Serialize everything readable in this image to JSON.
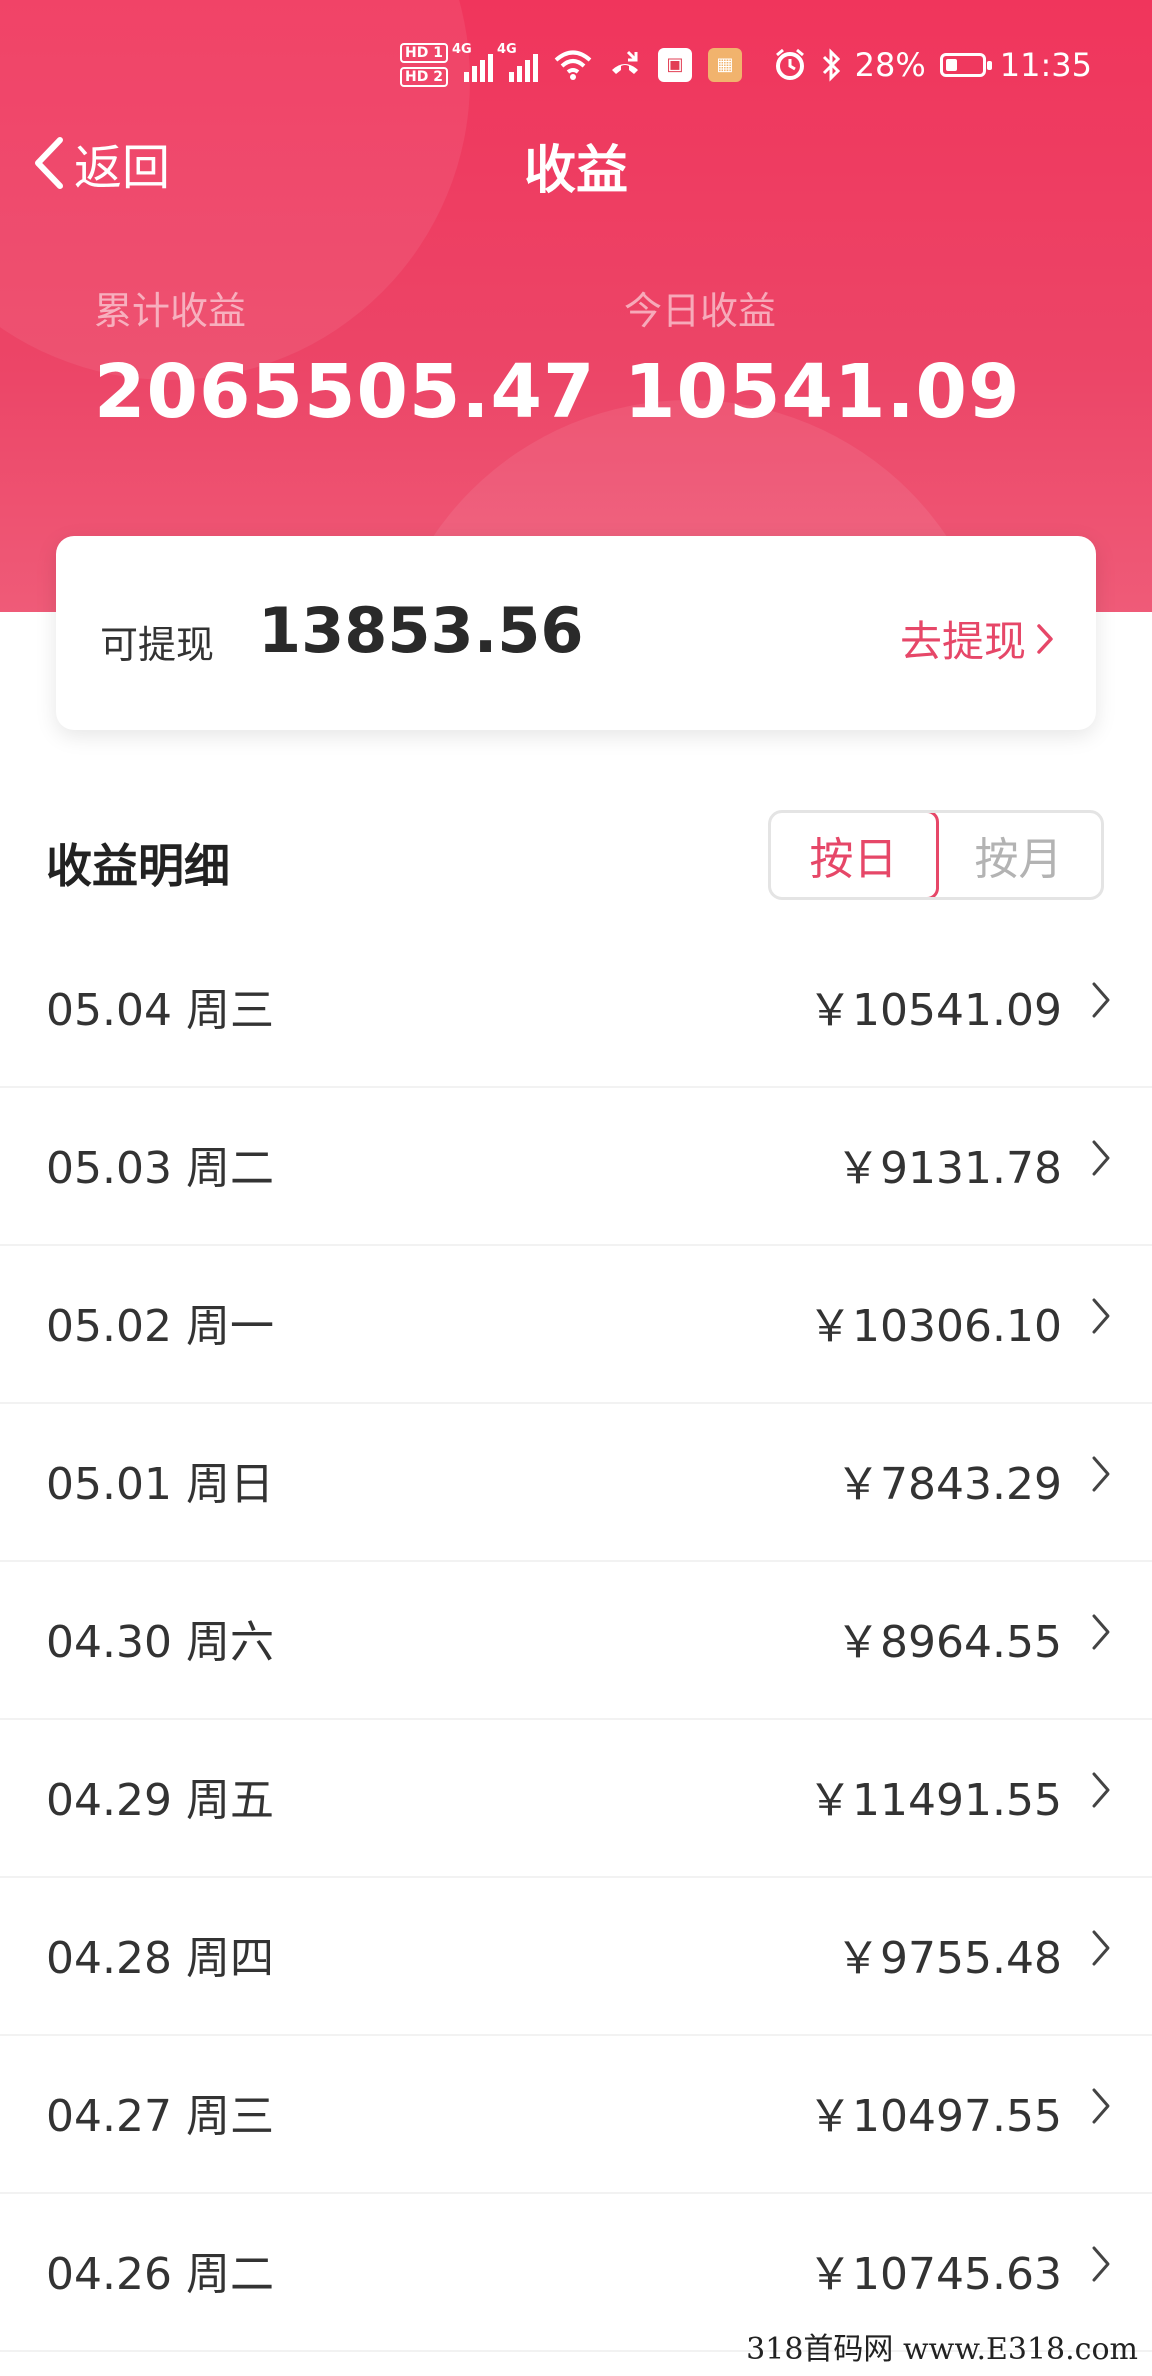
{
  "status_bar": {
    "hd1": "HD 1",
    "hd2": "HD 2",
    "net1": "4G",
    "net2": "4G",
    "battery": "28%",
    "time": "11:35"
  },
  "nav": {
    "back_label": "返回",
    "title": "收益"
  },
  "stats": {
    "total_label": "累计收益",
    "total_value": "2065505.47",
    "today_label": "今日收益",
    "today_value": "10541.09"
  },
  "withdraw": {
    "label": "可提现",
    "amount": "13853.56",
    "action": "去提现"
  },
  "detail": {
    "title": "收益明细",
    "tabs": [
      {
        "label": "按日",
        "active": true
      },
      {
        "label": "按月",
        "active": false
      }
    ]
  },
  "rows": [
    {
      "date": "05.04 周三",
      "amount": "￥10541.09"
    },
    {
      "date": "05.03 周二",
      "amount": "￥9131.78"
    },
    {
      "date": "05.02 周一",
      "amount": "￥10306.10"
    },
    {
      "date": "05.01 周日",
      "amount": "￥7843.29"
    },
    {
      "date": "04.30 周六",
      "amount": "￥8964.55"
    },
    {
      "date": "04.29 周五",
      "amount": "￥11491.55"
    },
    {
      "date": "04.28 周四",
      "amount": "￥9755.48"
    },
    {
      "date": "04.27 周三",
      "amount": "￥10497.55"
    },
    {
      "date": "04.26 周二",
      "amount": "￥10745.63"
    }
  ],
  "watermark": "318首码网 www.E318.com",
  "colors": {
    "header_bg": "#f0355c",
    "accent": "#e64768"
  }
}
